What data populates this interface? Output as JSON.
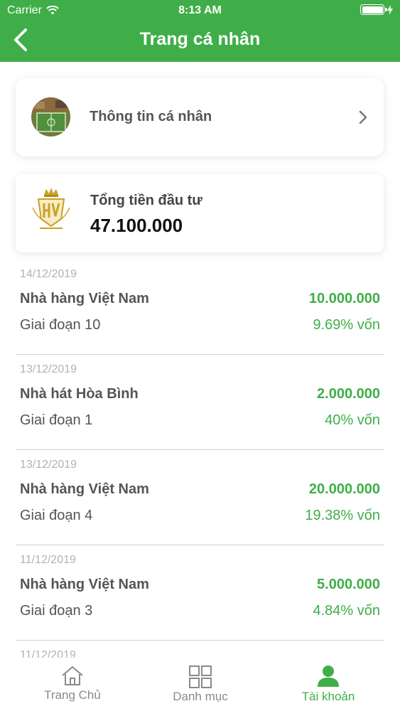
{
  "status_bar": {
    "carrier": "Carrier",
    "time": "8:13 AM"
  },
  "header": {
    "title": "Trang cá nhân",
    "back_icon": "chevron-left-icon"
  },
  "profile": {
    "label": "Thông tin cá nhân"
  },
  "investment": {
    "label": "Tổng tiền đầu tư",
    "total": "47.100.000"
  },
  "transactions": [
    {
      "date": "14/12/2019",
      "name": "Nhà hàng Việt Nam",
      "amount": "10.000.000",
      "phase": "Giai đoạn 10",
      "percent": "9.69% vốn"
    },
    {
      "date": "13/12/2019",
      "name": "Nhà hát Hòa Bình",
      "amount": "2.000.000",
      "phase": "Giai đoạn 1",
      "percent": "40% vốn"
    },
    {
      "date": "13/12/2019",
      "name": "Nhà hàng Việt Nam",
      "amount": "20.000.000",
      "phase": "Giai đoạn 4",
      "percent": "19.38% vốn"
    },
    {
      "date": "11/12/2019",
      "name": "Nhà hàng Việt Nam",
      "amount": "5.000.000",
      "phase": "Giai đoạn 3",
      "percent": "4.84% vốn"
    },
    {
      "date": "11/12/2019"
    }
  ],
  "tabs": [
    {
      "label": "Trang Chủ",
      "icon": "home-icon",
      "active": false
    },
    {
      "label": "Danh mục",
      "icon": "grid-icon",
      "active": false
    },
    {
      "label": "Tài khoản",
      "icon": "user-icon",
      "active": true
    }
  ],
  "colors": {
    "primary": "#3fae48",
    "text": "#555555",
    "muted": "#b2b2b2"
  }
}
